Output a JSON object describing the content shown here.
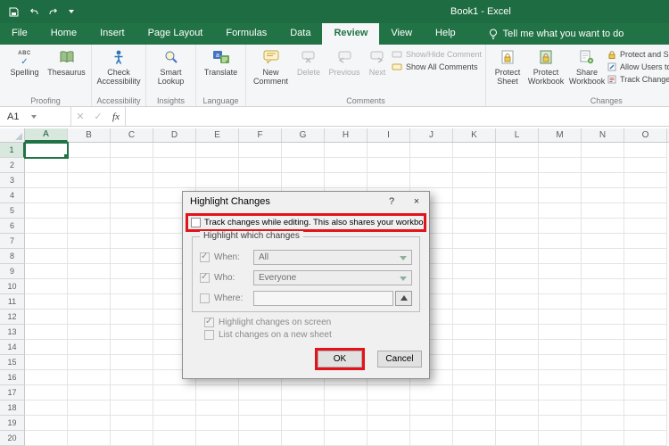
{
  "titlebar": {
    "title": "Book1 - Excel"
  },
  "ribbon": {
    "tabs": [
      {
        "label": "File"
      },
      {
        "label": "Home"
      },
      {
        "label": "Insert"
      },
      {
        "label": "Page Layout"
      },
      {
        "label": "Formulas"
      },
      {
        "label": "Data"
      },
      {
        "label": "Review",
        "active": true
      },
      {
        "label": "View"
      },
      {
        "label": "Help"
      }
    ],
    "tell_me": "Tell me what you want to do",
    "groups": {
      "proofing": {
        "label": "Proofing",
        "spelling": "Spelling",
        "thesaurus": "Thesaurus"
      },
      "accessibility": {
        "label": "Accessibility",
        "check_accessibility": "Check Accessibility"
      },
      "insights": {
        "label": "Insights",
        "smart_lookup": "Smart Lookup"
      },
      "language": {
        "label": "Language",
        "translate": "Translate"
      },
      "comments": {
        "label": "Comments",
        "new_comment": "New Comment",
        "delete": "Delete",
        "previous": "Previous",
        "next": "Next",
        "show_hide": "Show/Hide Comment",
        "show_all": "Show All Comments"
      },
      "changes": {
        "label": "Changes",
        "protect_sheet": "Protect Sheet",
        "protect_workbook": "Protect Workbook",
        "share_workbook": "Share Workbook",
        "protect_share": "Protect and Share Workbook",
        "allow_users": "Allow Users to Edit Ranges",
        "track_changes": "Track Changes"
      }
    }
  },
  "formula_bar": {
    "name_box": "A1",
    "cancel": "✕",
    "enter": "✓",
    "fx": "fx"
  },
  "grid": {
    "columns": [
      "A",
      "B",
      "C",
      "D",
      "E",
      "F",
      "G",
      "H",
      "I",
      "J",
      "K",
      "L",
      "M",
      "N",
      "O"
    ],
    "row_count": 20,
    "selected_column": "A",
    "selected_row": 1
  },
  "dialog": {
    "title": "Highlight Changes",
    "help": "?",
    "close": "×",
    "track_label": "Track changes while editing. This also shares your workbook.",
    "group_label": "Highlight which changes",
    "when_label": "When:",
    "when_value": "All",
    "who_label": "Who:",
    "who_value": "Everyone",
    "where_label": "Where:",
    "highlight_screen": "Highlight changes on screen",
    "list_new_sheet": "List changes on a new sheet",
    "ok": "OK",
    "cancel": "Cancel"
  },
  "colors": {
    "excel_green": "#217346",
    "highlight_red": "#E3131B"
  }
}
